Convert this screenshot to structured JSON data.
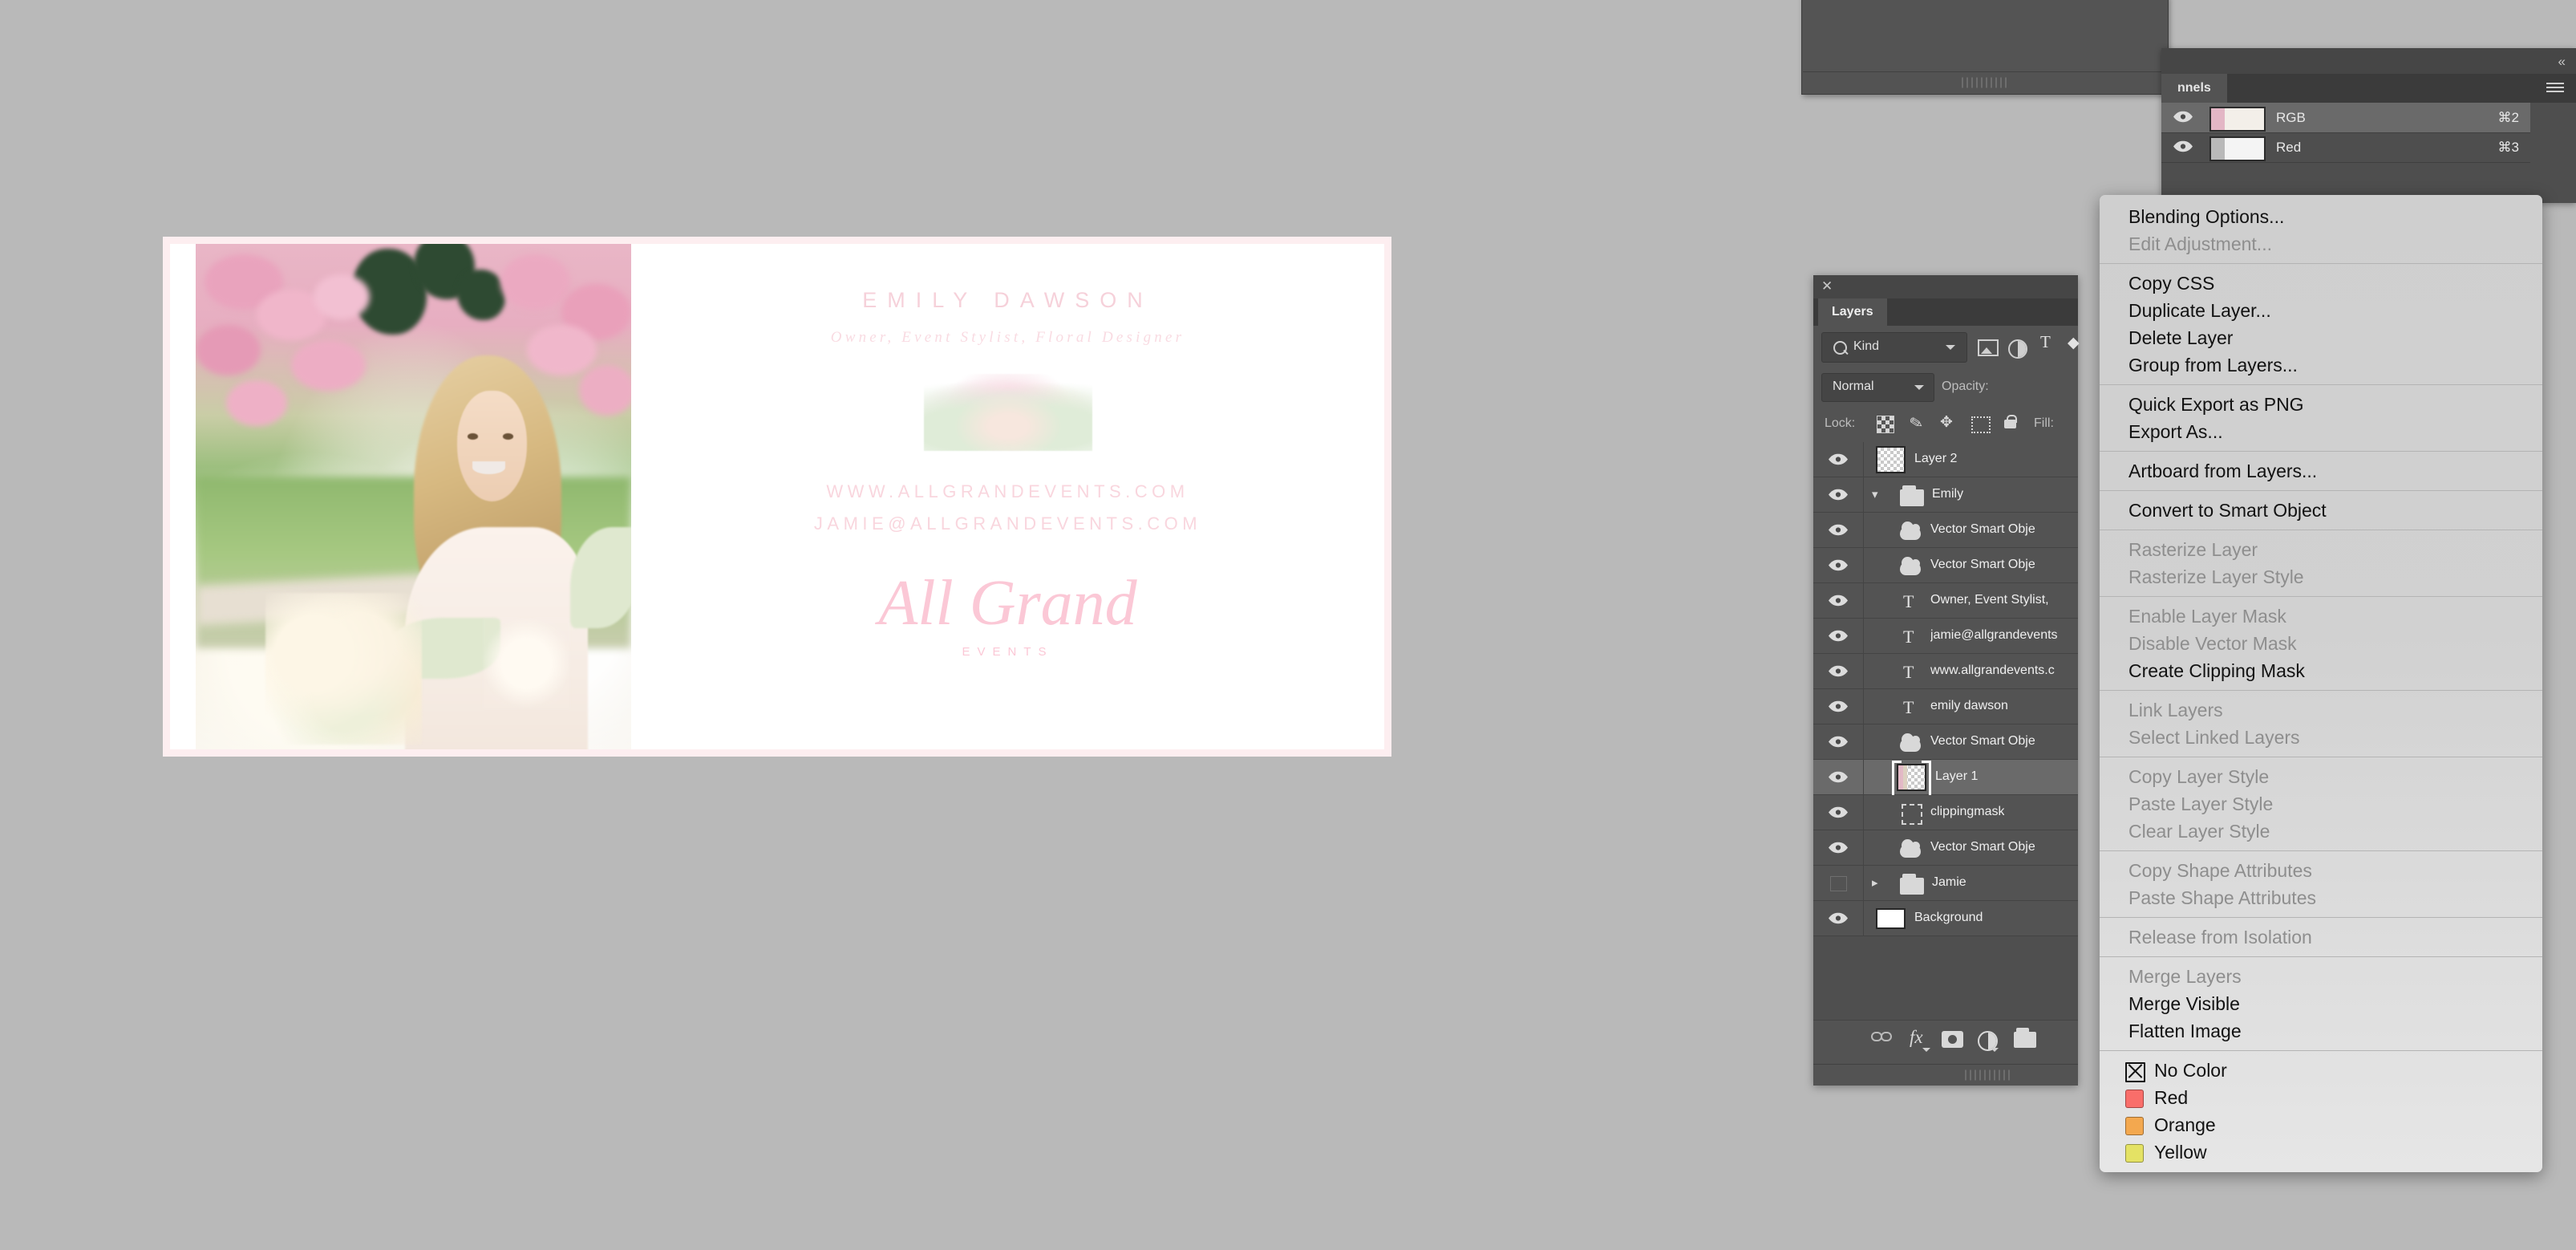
{
  "app": "Adobe Photoshop",
  "card": {
    "name": "EMILY DAWSON",
    "role": "Owner, Event Stylist, Floral Designer",
    "website": "WWW.ALLGRANDEVENTS.COM",
    "email": "JAMIE@ALLGRANDEVENTS.COM",
    "logo": "All Grand",
    "logo_sub": "EVENTS",
    "border_color": "#fdeef0",
    "text_color": "#f9d6de"
  },
  "channels_panel": {
    "tab_label": "nnels",
    "collapse_label": "«",
    "rows": [
      {
        "name": "RGB",
        "shortcut": "⌘2",
        "selected": true,
        "visible": true
      },
      {
        "name": "Red",
        "shortcut": "⌘3",
        "selected": false,
        "visible": true
      }
    ]
  },
  "layers_panel": {
    "close_label": "✕",
    "tab_label": "Layers",
    "filter": {
      "kind_label": "Kind"
    },
    "blend_mode": "Normal",
    "opacity_label": "Opacity:",
    "lock_label": "Lock:",
    "fill_label": "Fill:",
    "rows": [
      {
        "name": "Layer 2",
        "icon": "checker-thumb",
        "indent": 0,
        "visible": true,
        "selected": false
      },
      {
        "name": "Emily",
        "icon": "folder-icon",
        "indent": 0,
        "visible": true,
        "selected": false,
        "disclosure": "open"
      },
      {
        "name": "Vector Smart Obje",
        "icon": "smart-object-icon",
        "indent": 1,
        "visible": true,
        "selected": false
      },
      {
        "name": "Vector Smart Obje",
        "icon": "smart-object-icon",
        "indent": 1,
        "visible": true,
        "selected": false
      },
      {
        "name": "Owner, Event Stylist,",
        "icon": "text-layer-icon",
        "indent": 1,
        "visible": true,
        "selected": false
      },
      {
        "name": "jamie@allgrandevents",
        "icon": "text-layer-icon",
        "indent": 1,
        "visible": true,
        "selected": false
      },
      {
        "name": "www.allgrandevents.c",
        "icon": "text-layer-icon",
        "indent": 1,
        "visible": true,
        "selected": false
      },
      {
        "name": "emily dawson",
        "icon": "text-layer-icon",
        "indent": 1,
        "visible": true,
        "selected": false
      },
      {
        "name": "Vector Smart Obje",
        "icon": "smart-object-icon",
        "indent": 1,
        "visible": true,
        "selected": false
      },
      {
        "name": "Layer 1",
        "icon": "photo-thumb",
        "indent": 1,
        "visible": true,
        "selected": true
      },
      {
        "name": "clippingmask",
        "icon": "vector-mask-icon",
        "indent": 1,
        "visible": true,
        "selected": false
      },
      {
        "name": "Vector Smart Obje",
        "icon": "smart-object-icon",
        "indent": 1,
        "visible": true,
        "selected": false
      },
      {
        "name": "Jamie",
        "icon": "folder-icon",
        "indent": 0,
        "visible": false,
        "selected": false,
        "disclosure": "closed"
      },
      {
        "name": "Background",
        "icon": "white-thumb",
        "indent": 0,
        "visible": true,
        "selected": false
      }
    ]
  },
  "context_menu": {
    "groups": [
      [
        {
          "label": "Blending Options...",
          "enabled": true
        },
        {
          "label": "Edit Adjustment...",
          "enabled": false
        }
      ],
      [
        {
          "label": "Copy CSS",
          "enabled": true
        },
        {
          "label": "Duplicate Layer...",
          "enabled": true
        },
        {
          "label": "Delete Layer",
          "enabled": true
        },
        {
          "label": "Group from Layers...",
          "enabled": true
        }
      ],
      [
        {
          "label": "Quick Export as PNG",
          "enabled": true
        },
        {
          "label": "Export As...",
          "enabled": true
        }
      ],
      [
        {
          "label": "Artboard from Layers...",
          "enabled": true
        }
      ],
      [
        {
          "label": "Convert to Smart Object",
          "enabled": true
        }
      ],
      [
        {
          "label": "Rasterize Layer",
          "enabled": false
        },
        {
          "label": "Rasterize Layer Style",
          "enabled": false
        }
      ],
      [
        {
          "label": "Enable Layer Mask",
          "enabled": false
        },
        {
          "label": "Disable Vector Mask",
          "enabled": false
        },
        {
          "label": "Create Clipping Mask",
          "enabled": true
        }
      ],
      [
        {
          "label": "Link Layers",
          "enabled": false
        },
        {
          "label": "Select Linked Layers",
          "enabled": false
        }
      ],
      [
        {
          "label": "Copy Layer Style",
          "enabled": false
        },
        {
          "label": "Paste Layer Style",
          "enabled": false
        },
        {
          "label": "Clear Layer Style",
          "enabled": false
        }
      ],
      [
        {
          "label": "Copy Shape Attributes",
          "enabled": false
        },
        {
          "label": "Paste Shape Attributes",
          "enabled": false
        }
      ],
      [
        {
          "label": "Release from Isolation",
          "enabled": false
        }
      ],
      [
        {
          "label": "Merge Layers",
          "enabled": false
        },
        {
          "label": "Merge Visible",
          "enabled": true
        },
        {
          "label": "Flatten Image",
          "enabled": true
        }
      ]
    ],
    "colors": [
      {
        "label": "No Color",
        "swatch": "none",
        "enabled": true
      },
      {
        "label": "Red",
        "swatch": "#f96e6a",
        "enabled": true
      },
      {
        "label": "Orange",
        "swatch": "#f3a košt",
        "enabled": true
      },
      {
        "label": "Yellow",
        "swatch": "#e4e264",
        "enabled": true
      }
    ]
  }
}
